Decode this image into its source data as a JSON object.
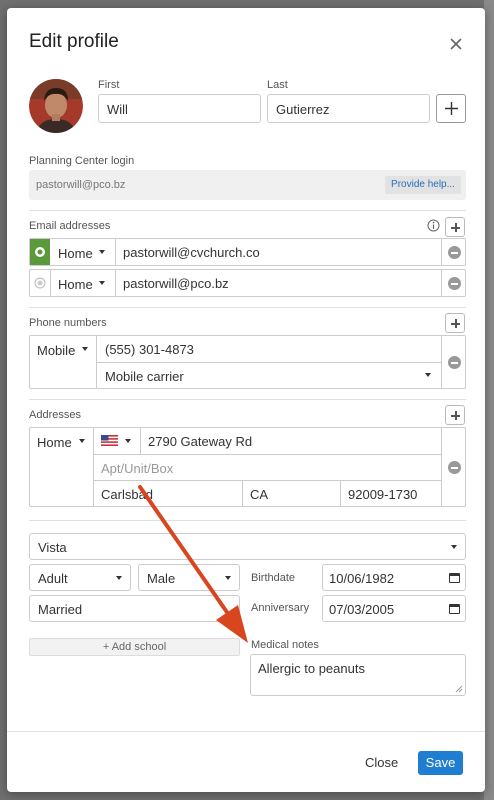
{
  "modal": {
    "title": "Edit profile",
    "close_label": "Close",
    "save_label": "Save"
  },
  "name": {
    "first_label": "First",
    "first_value": "Will",
    "last_label": "Last",
    "last_value": "Gutierrez"
  },
  "login": {
    "label": "Planning Center login",
    "value": "pastorwill@pco.bz",
    "help_label": "Provide help..."
  },
  "emails": {
    "label": "Email addresses",
    "items": [
      {
        "type": "Home",
        "address": "pastorwill@cvchurch.co",
        "primary": true
      },
      {
        "type": "Home",
        "address": "pastorwill@pco.bz",
        "primary": false
      }
    ]
  },
  "phones": {
    "label": "Phone numbers",
    "type": "Mobile",
    "number": "(555) 301-4873",
    "carrier": "Mobile carrier"
  },
  "addresses": {
    "label": "Addresses",
    "type": "Home",
    "street": "2790 Gateway Rd",
    "apt_placeholder": "Apt/Unit/Box",
    "city": "Carlsbad",
    "state": "CA",
    "zip": "92009-1730"
  },
  "details": {
    "campus": "Vista",
    "age_group": "Adult",
    "gender": "Male",
    "marital_status": "Married",
    "birthdate_label": "Birthdate",
    "birthdate": "10/06/1982",
    "anniversary_label": "Anniversary",
    "anniversary": "07/03/2005",
    "add_school_label": "Add school",
    "medical_label": "Medical notes",
    "medical_value": "Allergic to peanuts"
  },
  "colors": {
    "primary_email": "#5b9a3a",
    "save_button": "#1f7ed0",
    "annotation_arrow": "#d9451f"
  },
  "icons": {
    "close": "close-icon",
    "flag": "us-flag-icon",
    "info": "info-icon",
    "calendar": "calendar-icon"
  }
}
